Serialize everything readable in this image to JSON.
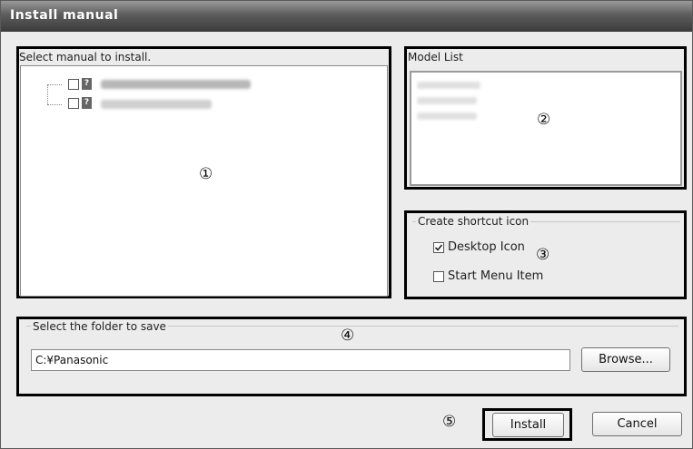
{
  "window": {
    "title": "Install manual"
  },
  "manual_panel": {
    "label": "Select manual to install.",
    "callout": "①",
    "items": [
      {
        "label": "",
        "checked": false,
        "icon": "question-icon"
      },
      {
        "label": "",
        "checked": false,
        "icon": "question-icon"
      }
    ]
  },
  "model_panel": {
    "label": "Model List",
    "callout": "②"
  },
  "shortcut_group": {
    "label": "Create shortcut icon",
    "callout": "③",
    "options": [
      {
        "label": "Desktop Icon",
        "checked": true
      },
      {
        "label": "Start Menu Item",
        "checked": false
      }
    ]
  },
  "folder_group": {
    "label": "Select the folder to save",
    "callout": "④",
    "path_value": "C:¥Panasonic",
    "browse_label": "Browse..."
  },
  "footer": {
    "callout": "⑤",
    "install_label": "Install",
    "cancel_label": "Cancel"
  }
}
